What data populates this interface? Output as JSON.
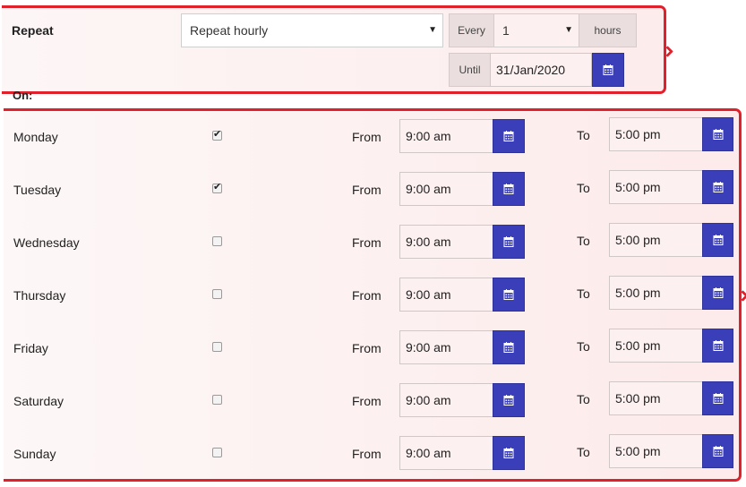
{
  "repeat": {
    "label": "Repeat",
    "mode_value": "Repeat hourly",
    "every_label": "Every",
    "every_value": "1",
    "hours_label": "hours",
    "until_label": "Until",
    "until_value": "31/Jan/2020"
  },
  "on_label": "On:",
  "days": [
    {
      "name": "Monday",
      "checked": true,
      "from_label": "From",
      "from": "9:00 am",
      "to_label": "To",
      "to": "5:00 pm"
    },
    {
      "name": "Tuesday",
      "checked": true,
      "from_label": "From",
      "from": "9:00 am",
      "to_label": "To",
      "to": "5:00 pm"
    },
    {
      "name": "Wednesday",
      "checked": false,
      "from_label": "From",
      "from": "9:00 am",
      "to_label": "To",
      "to": "5:00 pm"
    },
    {
      "name": "Thursday",
      "checked": false,
      "from_label": "From",
      "from": "9:00 am",
      "to_label": "To",
      "to": "5:00 pm"
    },
    {
      "name": "Friday",
      "checked": false,
      "from_label": "From",
      "from": "9:00 am",
      "to_label": "To",
      "to": "5:00 pm"
    },
    {
      "name": "Saturday",
      "checked": false,
      "from_label": "From",
      "from": "9:00 am",
      "to_label": "To",
      "to": "5:00 pm"
    },
    {
      "name": "Sunday",
      "checked": false,
      "from_label": "From",
      "from": "9:00 am",
      "to_label": "To",
      "to": "5:00 pm"
    }
  ],
  "icons": {
    "calendar": "calendar-icon",
    "dropdown": "chevron-down-icon",
    "check": "checkmark-icon"
  },
  "colors": {
    "highlight_border": "#e0202a",
    "button_bg": "#3a3eb8"
  }
}
